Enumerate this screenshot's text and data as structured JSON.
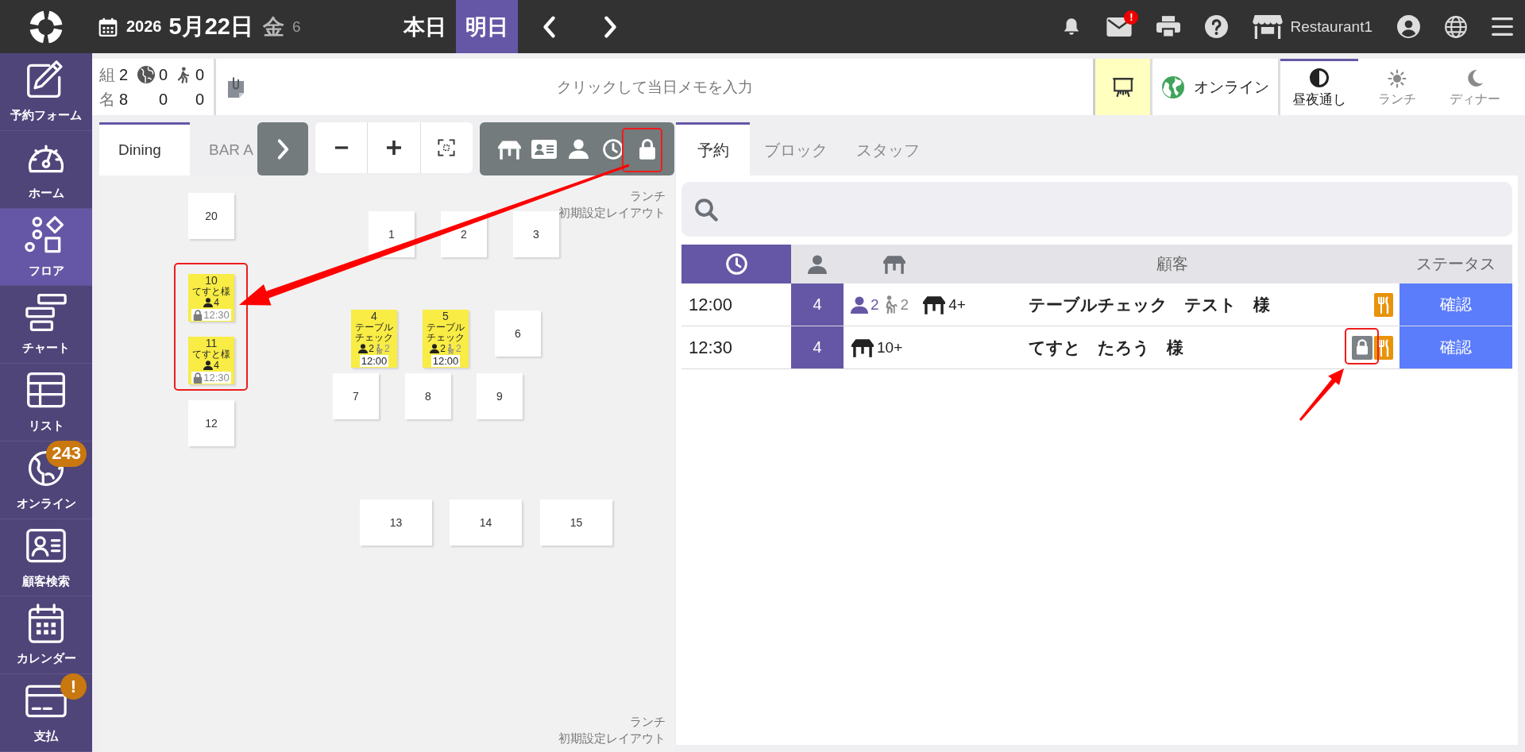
{
  "top_bar": {
    "year": "2026",
    "date": "5月22日",
    "weekday": "金",
    "day_note": "6",
    "day_buttons": [
      {
        "label": "本日",
        "selected": false
      },
      {
        "label": "明日",
        "selected": true
      }
    ],
    "mail_badge": "!",
    "store_name": "Restaurant1"
  },
  "sidebar": {
    "items": [
      {
        "label": "予約フォーム",
        "selected": false
      },
      {
        "label": "ホーム",
        "selected": false
      },
      {
        "label": "フロア",
        "selected": true
      },
      {
        "label": "チャート",
        "selected": false
      },
      {
        "label": "リスト",
        "selected": false
      },
      {
        "label": "オンライン",
        "selected": false,
        "badge": "243"
      },
      {
        "label": "顧客検索",
        "selected": false
      },
      {
        "label": "カレンダー",
        "selected": false
      },
      {
        "label": "支払",
        "selected": false,
        "badge": "!"
      }
    ]
  },
  "info_bar": {
    "summary": {
      "groups_label": "組",
      "groups": [
        "2",
        "0",
        "0"
      ],
      "people_label": "名",
      "people": [
        "8",
        "0",
        "0"
      ]
    },
    "memo": {
      "placeholder": "クリックして当日メモを入力"
    },
    "display_button": {
      "active": true
    },
    "online_button": {
      "label": "オンライン"
    },
    "service_tabs": [
      {
        "label": "昼夜通し",
        "selected": true
      },
      {
        "label": "ランチ",
        "selected": false
      },
      {
        "label": "ディナー",
        "selected": false
      }
    ]
  },
  "floor": {
    "tabs": [
      {
        "label": "Dining",
        "selected": true
      },
      {
        "label": "BAR A",
        "selected": false
      }
    ],
    "layout_labels": [
      {
        "service": "ランチ",
        "layout": "初期設定レイアウト"
      },
      {
        "service": "ランチ",
        "layout": "初期設定レイアウト"
      }
    ],
    "tables": [
      {
        "number": "20",
        "kind": "free"
      },
      {
        "number": "1",
        "kind": "free"
      },
      {
        "number": "2",
        "kind": "free"
      },
      {
        "number": "3",
        "kind": "free"
      },
      {
        "number": "10",
        "kind": "reserved",
        "name": "てすと様",
        "guests": "4",
        "time": "12:30",
        "locked": true
      },
      {
        "number": "4",
        "kind": "reserved",
        "name": "テーブルチェック",
        "guests": "2",
        "seniors": "2",
        "time": "12:00",
        "locked": false
      },
      {
        "number": "5",
        "kind": "reserved",
        "name": "テーブルチェック",
        "guests": "2",
        "seniors": "2",
        "time": "12:00",
        "locked": false
      },
      {
        "number": "6",
        "kind": "free"
      },
      {
        "number": "11",
        "kind": "reserved",
        "name": "てすと様",
        "guests": "4",
        "time": "12:30",
        "locked": true
      },
      {
        "number": "7",
        "kind": "free"
      },
      {
        "number": "8",
        "kind": "free"
      },
      {
        "number": "9",
        "kind": "free"
      },
      {
        "number": "12",
        "kind": "free"
      },
      {
        "number": "13",
        "kind": "free"
      },
      {
        "number": "14",
        "kind": "free"
      },
      {
        "number": "15",
        "kind": "free"
      }
    ]
  },
  "reservations": {
    "tabs": [
      {
        "label": "予約",
        "selected": true
      },
      {
        "label": "ブロック",
        "selected": false
      },
      {
        "label": "スタッフ",
        "selected": false
      }
    ],
    "columns": {
      "customer": "顧客",
      "status": "ステータス"
    },
    "rows": [
      {
        "time": "12:00",
        "guests": "4",
        "adults": "2",
        "seniors": "2",
        "table_size": "4+",
        "name": "テーブルチェック　テスト　様",
        "locked": false,
        "status": "確認"
      },
      {
        "time": "12:30",
        "guests": "4",
        "table_size": "10+",
        "name": "てすと　たろう　様",
        "locked": true,
        "status": "確認"
      }
    ]
  }
}
